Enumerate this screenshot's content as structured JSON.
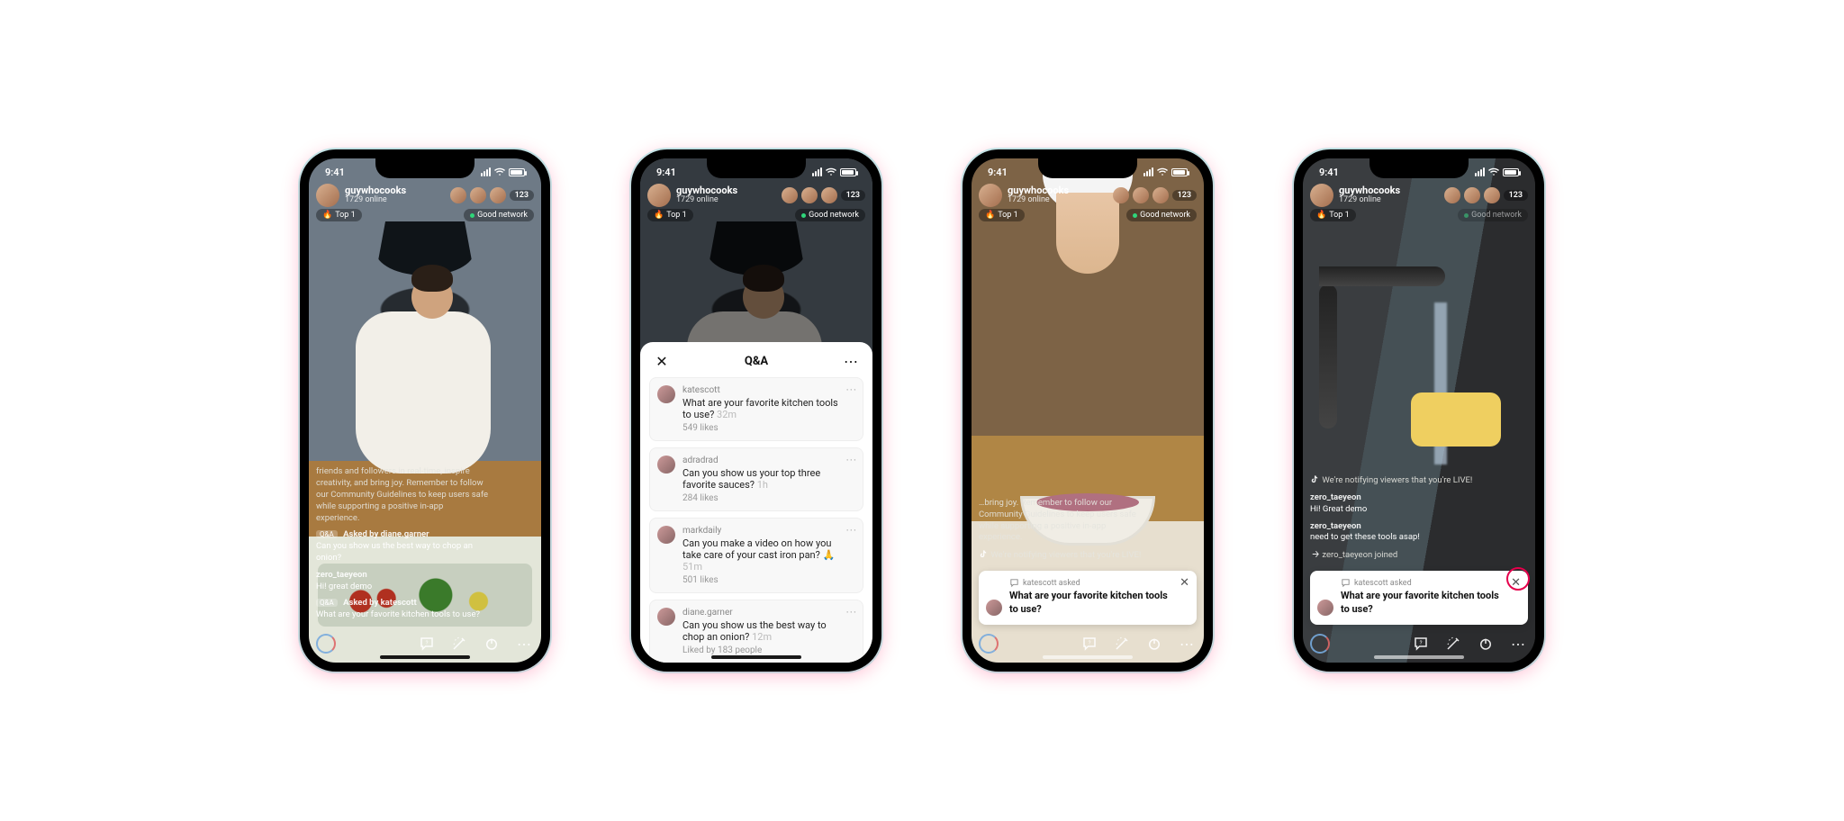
{
  "status": {
    "time": "9:41"
  },
  "creator": {
    "name": "guywhocooks",
    "online": "1729 online"
  },
  "viewers": {
    "count": "123"
  },
  "badges": {
    "top": "Top 1",
    "network": "Good network"
  },
  "guidelines_long": "friends and followers in real-time, inspire creativity, and bring joy. Remember to follow our Community Guidelines to keep users safe while supporting a positive in-app experience.",
  "guidelines_short": "…bring joy. Remember to follow our Community Guidelines to keep users safe while supporting a positive in-app experience.",
  "live_notice": "We're notifying viewers that you're LIVE!",
  "chat1": {
    "asked_by": "Asked by diane.garner",
    "q1": "Can you show us the best way to chop an onion?",
    "u2": "zero_taeyeon",
    "m2": "Hi! great demo",
    "asked_by2": "Asked by katescott",
    "q2": "What are your favorite kitchen tools to use?"
  },
  "chat4": {
    "u1": "zero_taeyeon",
    "m1": "Hi! Great demo",
    "u2": "zero_taeyeon",
    "m2": "need to get these tools asap!",
    "join": "zero_taeyeon joined"
  },
  "qa": {
    "title": "Q&A",
    "items": [
      {
        "user": "katescott",
        "text": "What are your favorite kitchen tools to use?",
        "time": "32m",
        "meta": "549 likes"
      },
      {
        "user": "adradrad",
        "text": "Can you show us your top three favorite sauces?",
        "time": "1h",
        "meta": "284 likes"
      },
      {
        "user": "markdaily",
        "text": "Can you make a video on how you take care of your cast iron pan? 🙏",
        "time": "51m",
        "meta": "501 likes"
      },
      {
        "user": "diane.garner",
        "text": "Can you show us the best way to chop an onion?",
        "time": "12m",
        "meta": "Liked by 183 people"
      }
    ]
  },
  "pinned": {
    "header": "katescott asked",
    "text": "What are your favorite kitchen tools to use?"
  },
  "icons": {
    "fire": "🔥",
    "wifi": "wifi",
    "comment": "comment",
    "effects": "magic",
    "power": "power",
    "more": "⋯",
    "close": "✕",
    "qa": "Q&A"
  }
}
